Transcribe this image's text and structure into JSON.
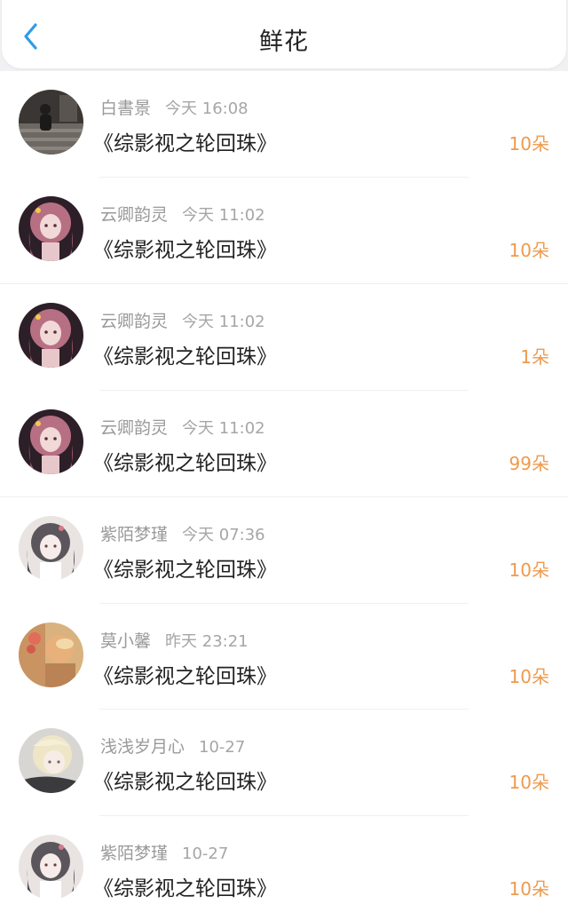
{
  "header": {
    "title": "鲜花",
    "back_icon": "chevron-left-icon",
    "accent_color": "#2f9be8"
  },
  "records": [
    {
      "name": "白書景",
      "time": "今天 16:08",
      "book": "《综影视之轮回珠》",
      "count": "10朵",
      "avatar": "avatar-dark-photo"
    },
    {
      "name": "云卿韵灵",
      "time": "今天 11:02",
      "book": "《综影视之轮回珠》",
      "count": "10朵",
      "avatar": "avatar-anime-pink"
    },
    {
      "name": "云卿韵灵",
      "time": "今天 11:02",
      "book": "《综影视之轮回珠》",
      "count": "1朵",
      "avatar": "avatar-anime-pink"
    },
    {
      "name": "云卿韵灵",
      "time": "今天 11:02",
      "book": "《综影视之轮回珠》",
      "count": "99朵",
      "avatar": "avatar-anime-pink"
    },
    {
      "name": "紫陌梦瑾",
      "time": "今天 07:36",
      "book": "《综影视之轮回珠》",
      "count": "10朵",
      "avatar": "avatar-anime-white"
    },
    {
      "name": "莫小馨",
      "time": "昨天 23:21",
      "book": "《综影视之轮回珠》",
      "count": "10朵",
      "avatar": "avatar-warm-photo"
    },
    {
      "name": "浅浅岁月心",
      "time": "10-27",
      "book": "《综影视之轮回珠》",
      "count": "10朵",
      "avatar": "avatar-blonde"
    },
    {
      "name": "紫陌梦瑾",
      "time": "10-27",
      "book": "《综影视之轮回珠》",
      "count": "10朵",
      "avatar": "avatar-anime-white"
    }
  ],
  "colors": {
    "count": "#ee9a4d",
    "title": "#222222",
    "meta": "#9a9a9a",
    "background": "#f1f1f3"
  }
}
